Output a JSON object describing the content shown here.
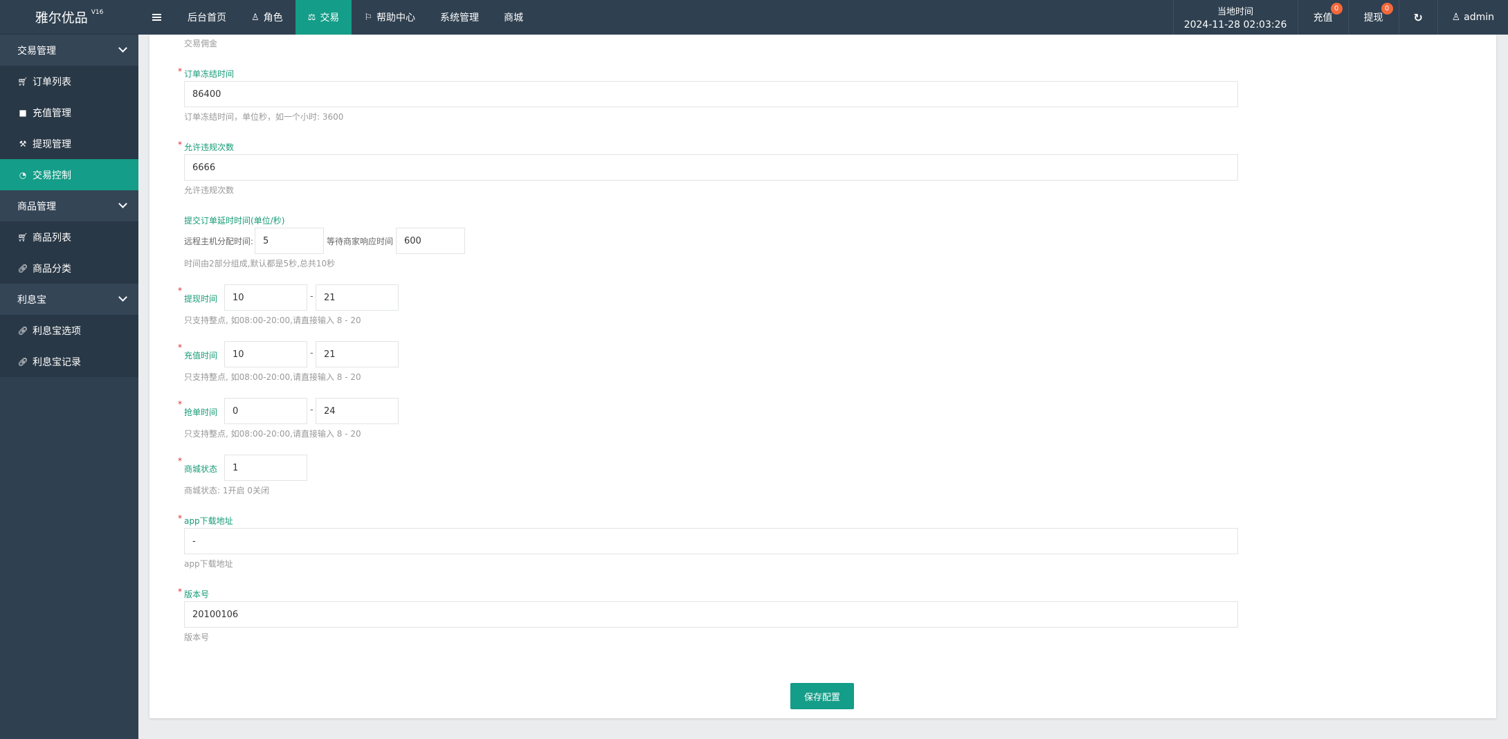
{
  "app": {
    "name": "雅尔优品",
    "version": "V16"
  },
  "sidebar": {
    "groups": [
      {
        "label": "交易管理",
        "items": [
          {
            "label": "订单列表",
            "icon": "cart-icon"
          },
          {
            "label": "充值管理",
            "icon": "comment-icon"
          },
          {
            "label": "提现管理",
            "icon": "gavel-icon"
          },
          {
            "label": "交易控制",
            "icon": "dashboard-icon",
            "active": true
          }
        ]
      },
      {
        "label": "商品管理",
        "items": [
          {
            "label": "商品列表",
            "icon": "cart-icon"
          },
          {
            "label": "商品分类",
            "icon": "link-icon"
          }
        ]
      },
      {
        "label": "利息宝",
        "items": [
          {
            "label": "利息宝选项",
            "icon": "link-icon"
          },
          {
            "label": "利息宝记录",
            "icon": "link-icon"
          }
        ]
      }
    ]
  },
  "header": {
    "menu": [
      {
        "label": "后台首页",
        "icon": ""
      },
      {
        "label": "角色",
        "icon": "user-icon"
      },
      {
        "label": "交易",
        "icon": "balance-icon",
        "active": true
      },
      {
        "label": "帮助中心",
        "icon": "flag-icon"
      },
      {
        "label": "系统管理",
        "icon": ""
      },
      {
        "label": "商城",
        "icon": ""
      }
    ],
    "time_label": "当地时间",
    "time_value": "2024-11-28 02:03:26",
    "recharge": {
      "label": "充值",
      "count": "0"
    },
    "withdraw": {
      "label": "提现",
      "count": "0"
    },
    "user": "admin"
  },
  "form": {
    "top_help": "交易佣金",
    "freeze": {
      "label": "订单冻结时间",
      "value": "86400",
      "help": "订单冻结时间，单位秒，如一个小时: 3600"
    },
    "violations": {
      "label": "允许违规次数",
      "value": "6666",
      "help": "允许违规次数"
    },
    "delay": {
      "label": "提交订单延时时间(单位/秒)",
      "host_label": "远程主机分配时间:",
      "host_value": "5",
      "merchant_label": "等待商家响应时间",
      "merchant_value": "600",
      "help": "时间由2部分组成,默认都是5秒,总共10秒"
    },
    "withdraw_time": {
      "label": "提现时间",
      "from": "10",
      "to": "21",
      "help": "只支持整点, 如08:00-20:00,请直接输入 8 - 20"
    },
    "recharge_time": {
      "label": "充值时间",
      "from": "10",
      "to": "21",
      "help": "只支持整点, 如08:00-20:00,请直接输入 8 - 20"
    },
    "grab_time": {
      "label": "抢单时间",
      "from": "0",
      "to": "24",
      "help": "只支持整点, 如08:00-20:00,请直接输入 8 - 20"
    },
    "mall_status": {
      "label": "商城状态",
      "value": "1",
      "help": "商城状态: 1开启 0关闭"
    },
    "app_url": {
      "label": "app下载地址",
      "value": "-",
      "help": "app下载地址"
    },
    "version": {
      "label": "版本号",
      "value": "20100106",
      "help": "版本号"
    },
    "dash": "-",
    "required_mark": "*",
    "save_label": "保存配置"
  },
  "colors": {
    "accent": "#149d88",
    "sidebar": "#2f4050",
    "label_green": "#169b77",
    "badge": "#f4683c"
  }
}
